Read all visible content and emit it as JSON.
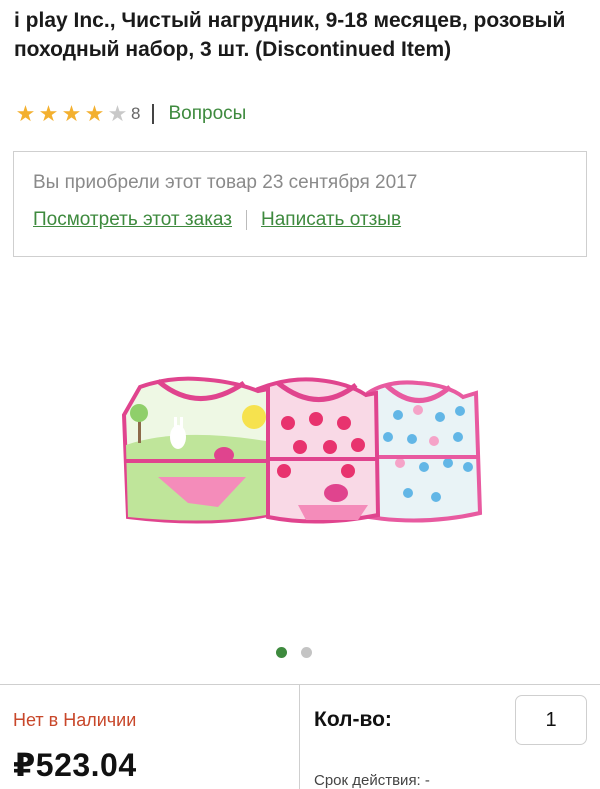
{
  "product": {
    "title": "i play Inc., Чистый нагрудник, 9-18 месяцев, розовый походный набор, 3 шт. (Discontinued Item)",
    "rating": {
      "stars": 4,
      "max_stars": 5,
      "count": "8"
    },
    "questions_link": "Вопросы"
  },
  "purchase_info": {
    "text": "Вы приобрели этот товар 23 сентября 2017",
    "view_order_link": "Посмотреть этот заказ",
    "write_review_link": "Написать отзыв"
  },
  "gallery": {
    "image_count": 2,
    "active_index": 0
  },
  "buy_panel": {
    "stock_status": "Нет в Наличии",
    "price": "₽523.04",
    "qty_label": "Кол-во:",
    "qty_value": "1",
    "expiry_label": "Срок действия: -"
  },
  "colors": {
    "accent_green": "#3e8a3e",
    "star_gold": "#f3b02f",
    "out_of_stock_red": "#c8472a"
  }
}
